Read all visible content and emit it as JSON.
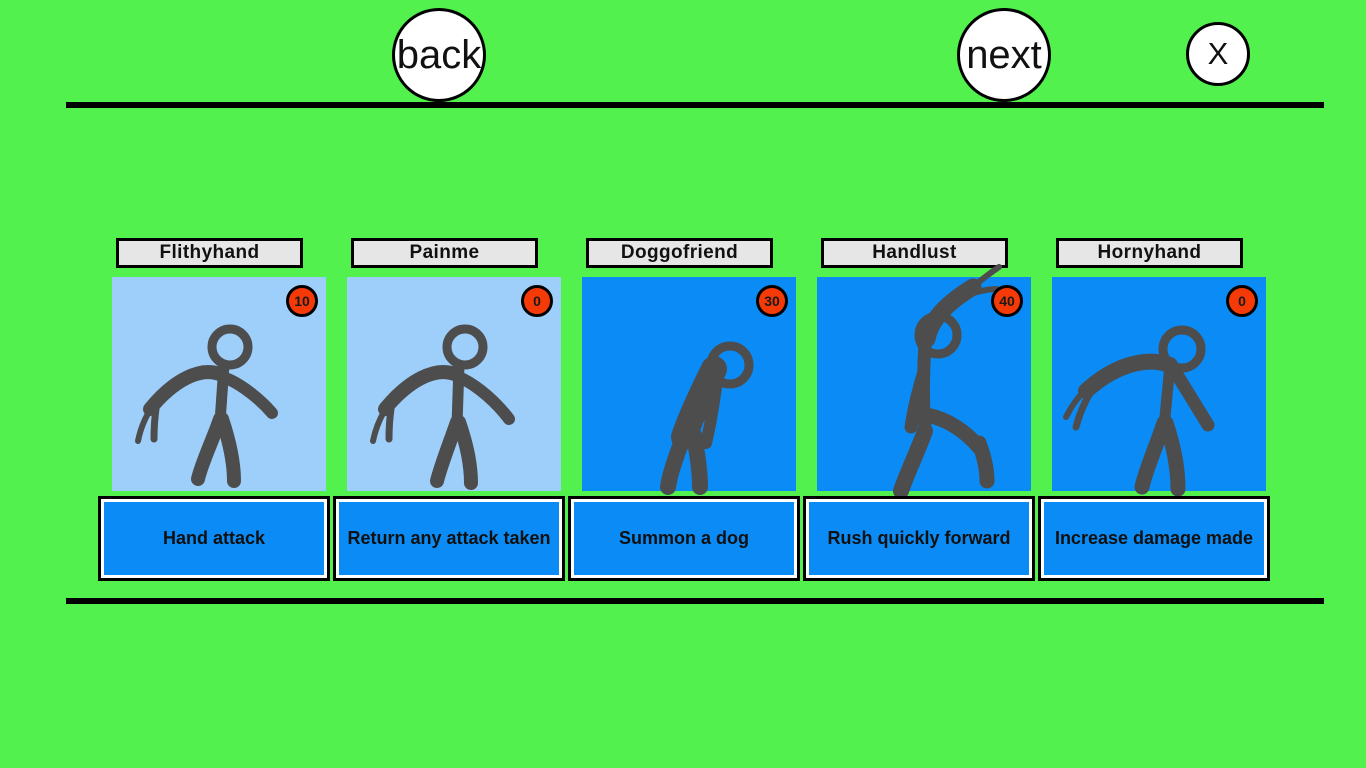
{
  "theme": {
    "background": "#52f14e",
    "divider": "#000000",
    "card_art_light": "#9ecffa",
    "card_art_blue": "#0b8bf5",
    "desc_fill": "#0b8bf5",
    "title_fill": "#e6e6e6",
    "badge_fill": "#f53a08",
    "figure": "#4d4d4d"
  },
  "nav": {
    "back_label": "back",
    "next_label": "next",
    "close_label": "X"
  },
  "cards": [
    {
      "title": "Flithyhand",
      "cost": "10",
      "description": "Hand attack",
      "art_bg": "#9ecffa",
      "pose": "reach-left"
    },
    {
      "title": "Painme",
      "cost": "0",
      "description": "Return any attack taken",
      "art_bg": "#9ecffa",
      "pose": "reach-left"
    },
    {
      "title": "Doggofriend",
      "cost": "30",
      "description": "Summon a dog",
      "art_bg": "#0b8bf5",
      "pose": "lean-forward"
    },
    {
      "title": "Handlust",
      "cost": "40",
      "description": "Rush quickly forward",
      "art_bg": "#0b8bf5",
      "pose": "arm-up"
    },
    {
      "title": "Hornyhand",
      "cost": "0",
      "description": "Increase damage made",
      "art_bg": "#0b8bf5",
      "pose": "reach-far-left"
    }
  ]
}
